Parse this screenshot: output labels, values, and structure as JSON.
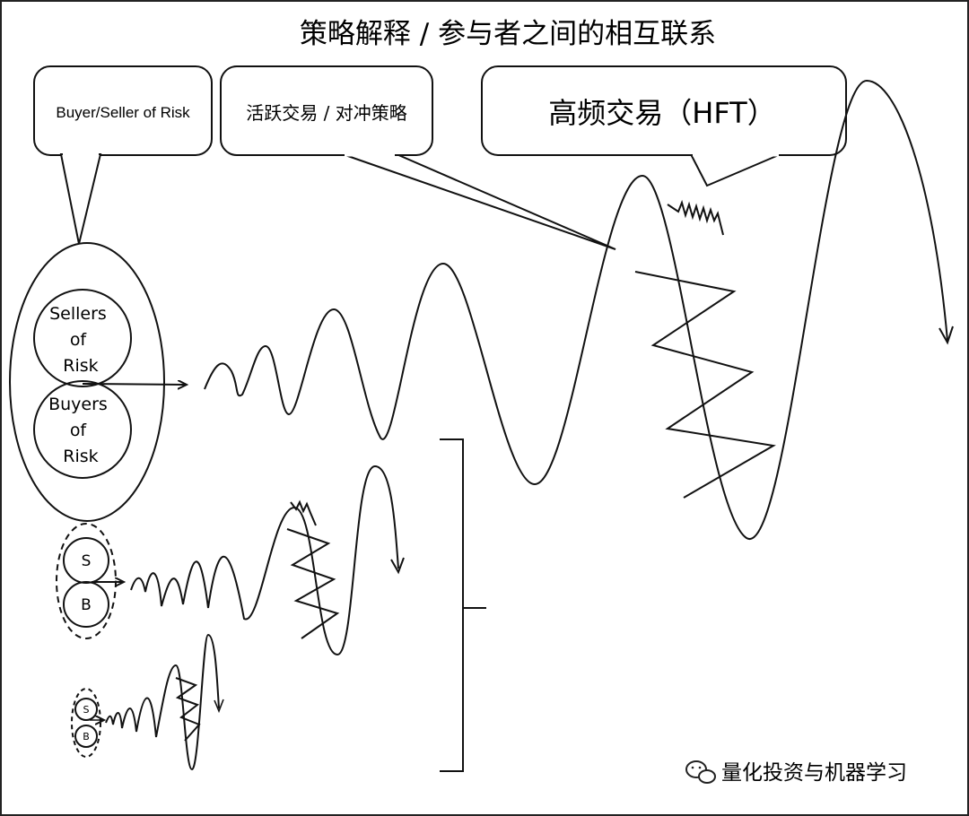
{
  "title": "策略解释 / 参与者之间的相互联系",
  "bubbles": {
    "risk": "Buyer/Seller of Risk",
    "active": "活跃交易 / 对冲策略",
    "hft": "高频交易（HFT）"
  },
  "large_group": {
    "sellers": [
      "Sellers",
      "of",
      "Risk"
    ],
    "buyers": [
      "Buyers",
      "of",
      "Risk"
    ]
  },
  "medium_group": {
    "s": "S",
    "b": "B"
  },
  "small_group": {
    "s": "S",
    "b": "B"
  },
  "watermark": "量化投资与机器学习",
  "icons": {
    "watermark": "wechat-icon"
  },
  "colors": {
    "ink": "#111111",
    "background": "#ffffff"
  }
}
